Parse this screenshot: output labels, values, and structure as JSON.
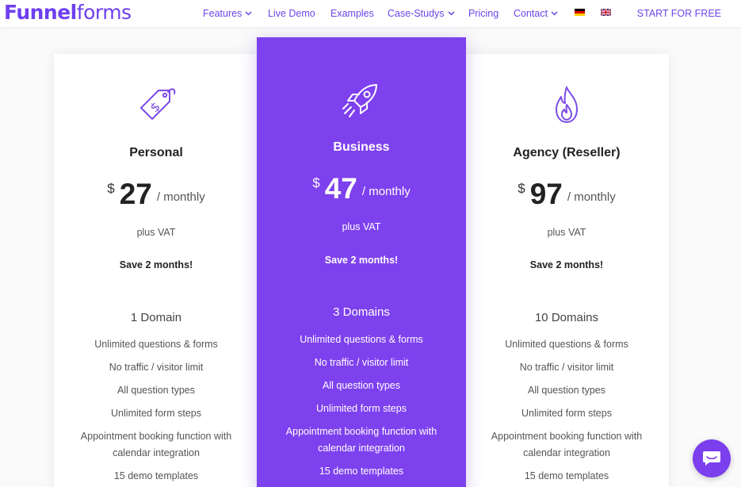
{
  "brand": {
    "logo_bold": "Funnel",
    "logo_light": "forms",
    "accent": "#7e41ee"
  },
  "nav": {
    "items": [
      {
        "label": "Features",
        "dropdown": true
      },
      {
        "label": "Live Demo",
        "dropdown": false
      },
      {
        "label": "Examples",
        "dropdown": false
      },
      {
        "label": "Case-Studys",
        "dropdown": true
      },
      {
        "label": "Pricing",
        "dropdown": false
      },
      {
        "label": "Contact",
        "dropdown": true
      }
    ],
    "flags": [
      "german-flag-icon",
      "uk-flag-icon"
    ],
    "cta": "START FOR FREE"
  },
  "plans": [
    {
      "icon": "price-tag-icon",
      "name": "Personal",
      "currency": "$",
      "amount": "27",
      "period": "/ monthly",
      "vat": "plus VAT",
      "save": "Save 2 months!",
      "domains": "1 Domain",
      "features": [
        "Unlimited questions & forms",
        "No traffic / visitor limit",
        "All question types",
        "Unlimited form steps",
        "Appointment booking function with calendar integration",
        "15 demo templates"
      ]
    },
    {
      "icon": "rocket-icon",
      "name": "Business",
      "currency": "$",
      "amount": "47",
      "period": "/ monthly",
      "vat": "plus VAT",
      "save": "Save 2 months!",
      "domains": "3 Domains",
      "features": [
        "Unlimited questions & forms",
        "No traffic / visitor limit",
        "All question types",
        "Unlimited form steps",
        "Appointment booking function with calendar integration",
        "15 demo templates"
      ]
    },
    {
      "icon": "flame-icon",
      "name": "Agency (Reseller)",
      "currency": "$",
      "amount": "97",
      "period": "/ monthly",
      "vat": "plus VAT",
      "save": "Save 2 months!",
      "domains": "10 Domains",
      "features": [
        "Unlimited questions & forms",
        "No traffic / visitor limit",
        "All question types",
        "Unlimited form steps",
        "Appointment booking function with calendar integration",
        "15 demo templates"
      ]
    }
  ],
  "chat": {
    "icon": "chat-bubble-icon"
  }
}
